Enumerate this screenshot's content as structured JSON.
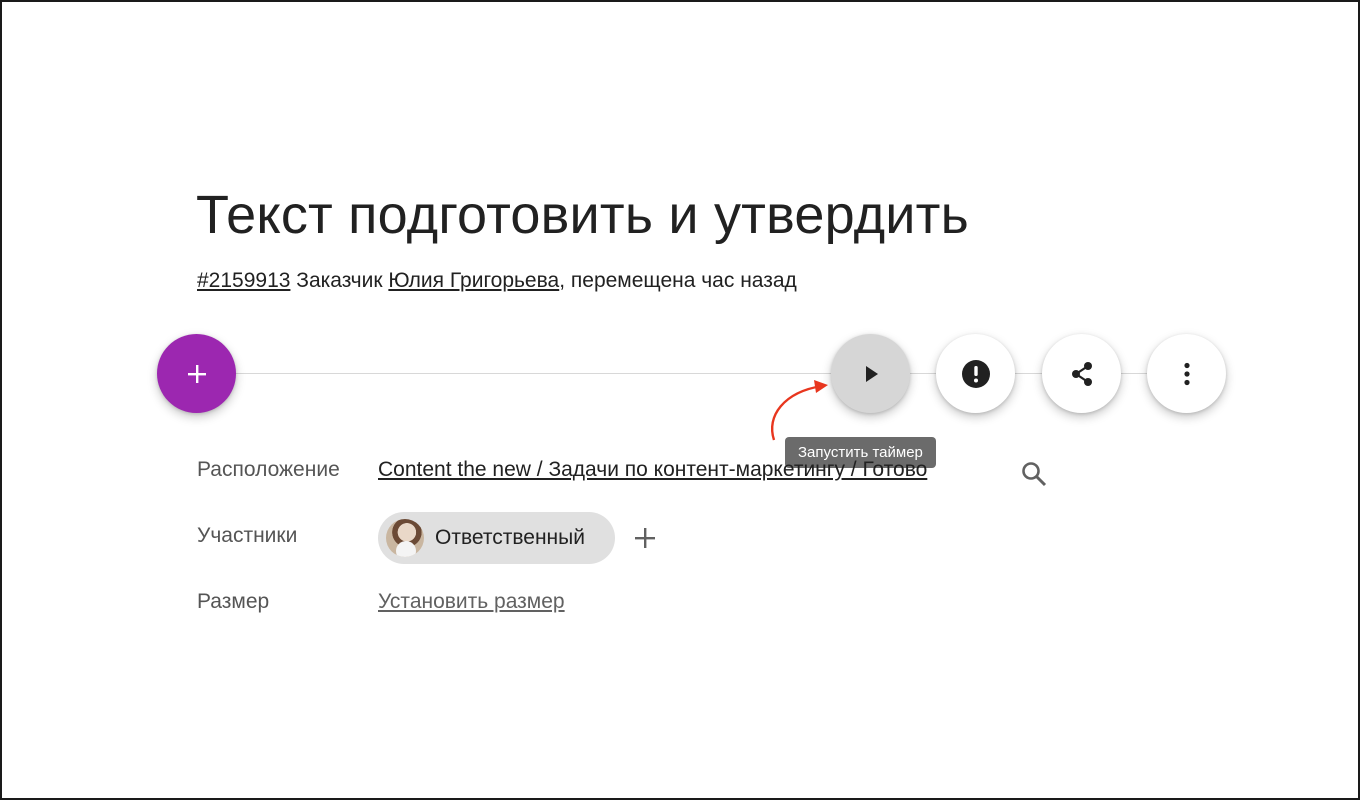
{
  "task": {
    "title": "Текст подготовить и утвердить",
    "id": "#2159913",
    "customer_label": "Заказчик",
    "customer_name": "Юлия Григорьева",
    "moved_text": ", перемещена час назад"
  },
  "toolbar": {
    "add_icon": "plus-icon",
    "play_icon": "play-icon",
    "alert_icon": "alert-icon",
    "share_icon": "share-icon",
    "more_icon": "more-vert-icon",
    "tooltip": "Запустить таймер",
    "add_color": "#9c27b0"
  },
  "details": {
    "location_label": "Расположение",
    "location_value": "Content the new / Задачи по контент-маркетингу / Готово",
    "participants_label": "Участники",
    "participant_role": "Ответственный",
    "size_label": "Размер",
    "size_action": "Установить размер"
  },
  "colors": {
    "annotation_arrow": "#e8361e"
  }
}
